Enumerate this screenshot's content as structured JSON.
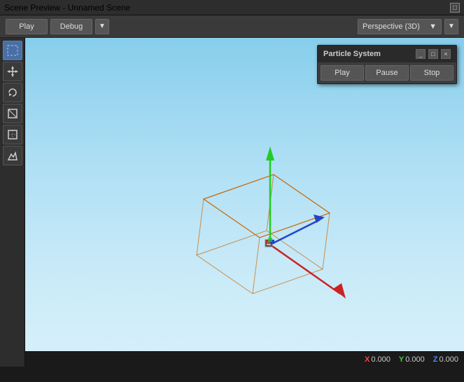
{
  "titleBar": {
    "title": "Scene Preview - Unnamed Scene"
  },
  "toolbar": {
    "playLabel": "Play",
    "debugLabel": "Debug",
    "dropdownArrow": "▼",
    "perspectiveLabel": "Perspective (3D)",
    "perspectiveArrow": "▼"
  },
  "leftTools": [
    {
      "name": "select-tool",
      "icon": "⬜",
      "active": true
    },
    {
      "name": "move-tool",
      "icon": "✛",
      "active": false
    },
    {
      "name": "rotate-tool",
      "icon": "↺",
      "active": false
    },
    {
      "name": "scale-tool",
      "icon": "⬡",
      "active": false
    },
    {
      "name": "rect-tool",
      "icon": "⬜",
      "active": false
    },
    {
      "name": "mountain-tool",
      "icon": "⛰",
      "active": false
    }
  ],
  "particlePanel": {
    "title": "Particle System",
    "minimizeLabel": "_",
    "maximizeLabel": "□",
    "closeLabel": "×",
    "playLabel": "Play",
    "pauseLabel": "Pause",
    "stopLabel": "Stop"
  },
  "statusBar": {
    "xLabel": "X",
    "xValue": "0.000",
    "yLabel": "Y",
    "yValue": "0.000",
    "zLabel": "Z",
    "zValue": "0.000"
  },
  "colors": {
    "accent": "#4a6fa5",
    "background": "#3a3a3a",
    "viewportGradientTop": "#87ceeb",
    "viewportGradientBottom": "#d8f0fa",
    "axisX": "#cc2222",
    "axisY": "#22cc22",
    "axisZ": "#2244cc",
    "wireframe": "#cc6600"
  }
}
